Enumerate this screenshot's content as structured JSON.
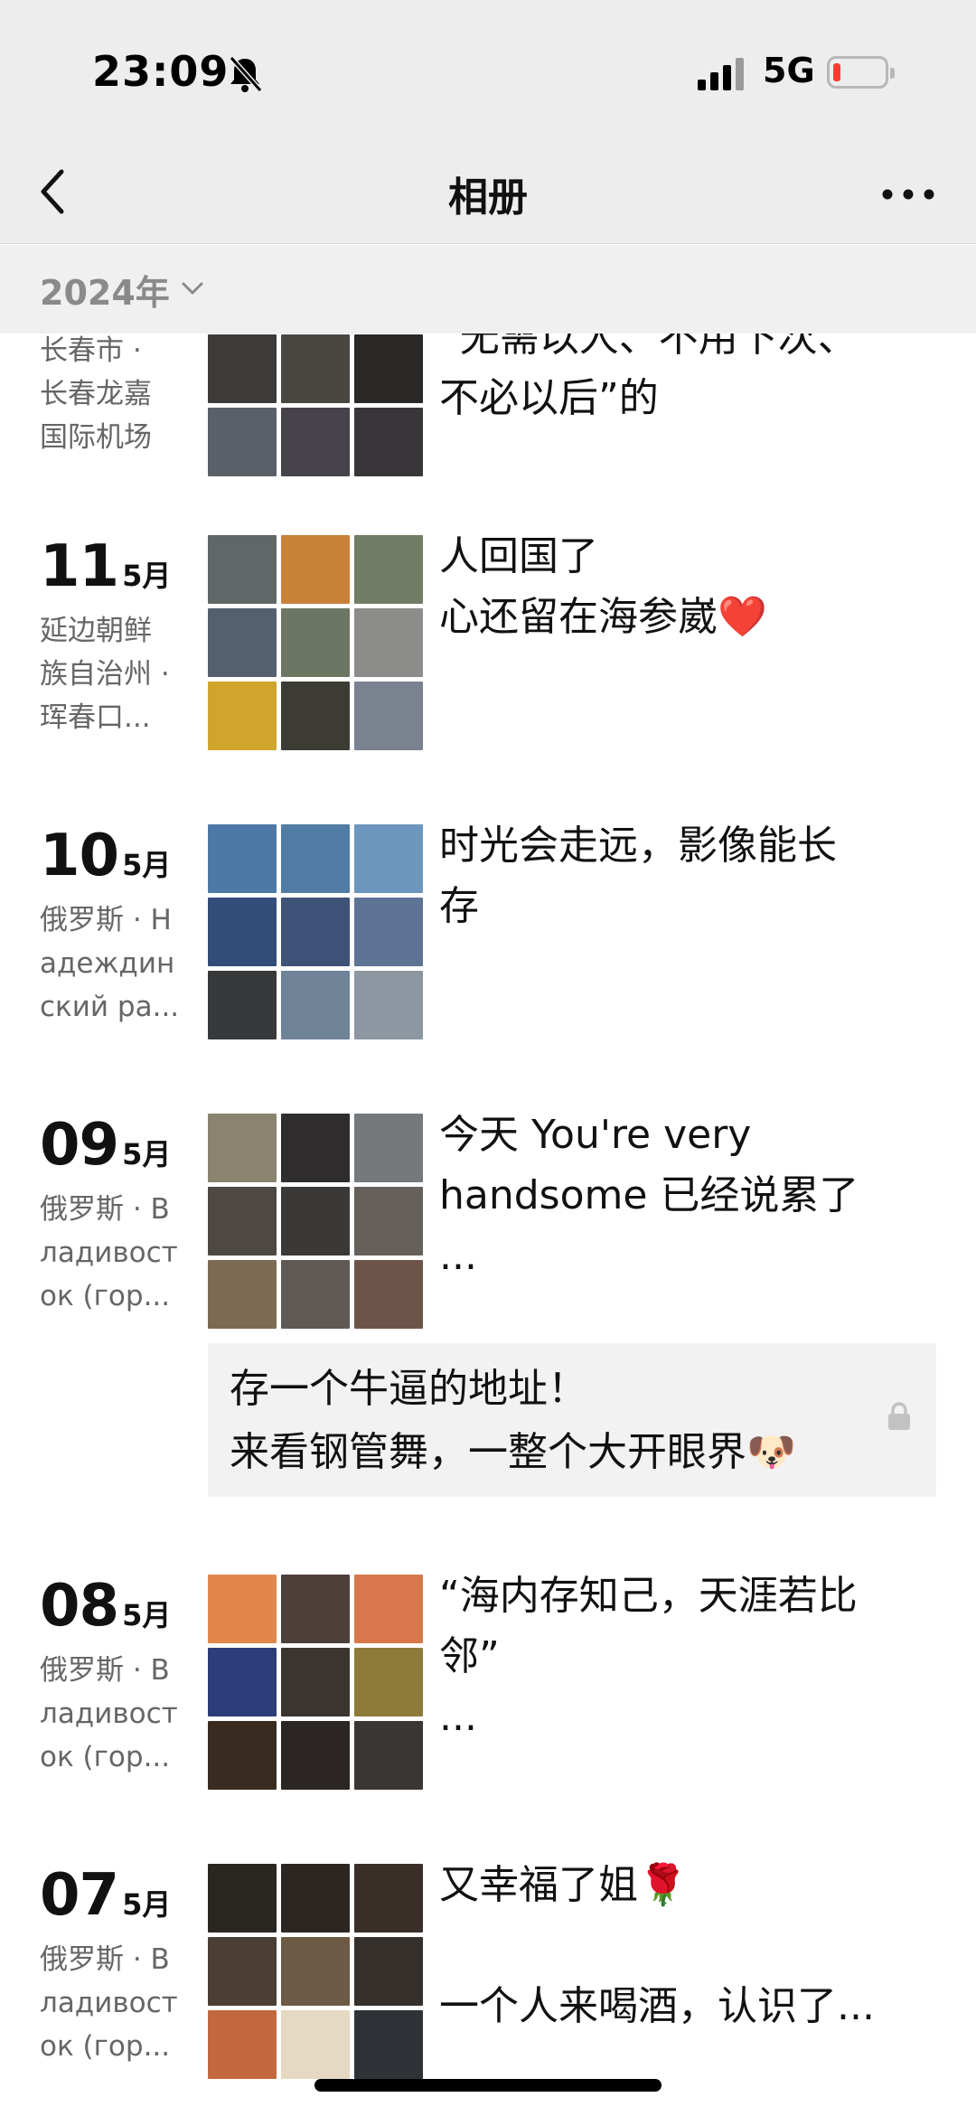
{
  "status": {
    "time": "23:09",
    "network": "5G",
    "battery_color": "#ff3b30"
  },
  "nav": {
    "title": "相册"
  },
  "year_header": {
    "label": "2024年"
  },
  "entries": [
    {
      "day": "",
      "month": "",
      "location": [
        "长春市 ·",
        "长春龙嘉",
        "国际机场"
      ],
      "caption": [
        "“无需以人、不用下次、",
        "不必以后”的"
      ],
      "photo_colors": [
        "#3c3b39",
        "#4a4642",
        "#2a2827",
        "#5b6068",
        "#46424a",
        "#39363a",
        "#514c47",
        "#2f3136",
        "#5d5549"
      ]
    },
    {
      "day": "11",
      "month": "5月",
      "location": [
        "延边朝鲜",
        "族自治州 ·",
        "珲春口..."
      ],
      "caption": [
        "人回国了",
        "心还留在海参崴❤️"
      ],
      "photo_colors": [
        "#5f6866",
        "#c9813a",
        "#707c64",
        "#54606e",
        "#6d7663",
        "#8c8d8b",
        "#d0a52c",
        "#3c3b34",
        "#7a8290"
      ]
    },
    {
      "day": "10",
      "month": "5月",
      "location": [
        "俄罗斯 · Н",
        "адеждин",
        "ский ра..."
      ],
      "caption": [
        "时光会走远，影像能长",
        "存"
      ],
      "photo_colors": [
        "#4d79a7",
        "#507ca5",
        "#6c96bd",
        "#324d79",
        "#3f5277",
        "#5d7494",
        "#37393b",
        "#6f8399",
        "#8c97a1"
      ]
    },
    {
      "day": "09",
      "month": "5月",
      "location": [
        "俄罗斯 · В",
        "ладивост",
        "ок (гор..."
      ],
      "caption": [
        "今天 You're very",
        "handsome 已经说累了",
        "..."
      ],
      "photo_colors": [
        "#8a8370",
        "#2e2c2c",
        "#75797b",
        "#4d4843",
        "#3a3937",
        "#66605a",
        "#7d6a52",
        "#5f5a55",
        "#6e5448"
      ]
    },
    {
      "day": "08",
      "month": "5月",
      "location": [
        "俄罗斯 · В",
        "ладивост",
        "ок (гор..."
      ],
      "caption": [
        "“海内存知己，天涯若比",
        "邻”",
        "..."
      ],
      "photo_colors": [
        "#e2874b",
        "#4d3f3a",
        "#d8774c",
        "#2d3d79",
        "#3b3530",
        "#8e7a3b",
        "#3a2b20",
        "#2b2523",
        "#3a3633"
      ]
    },
    {
      "day": "07",
      "month": "5月",
      "location": [
        "俄罗斯 · В",
        "ладивост",
        "ок (гор..."
      ],
      "caption": [
        "又幸福了姐🌹",
        "",
        "一个人来喝酒，认识了..."
      ],
      "photo_colors": [
        "#2a2622",
        "#2c2622",
        "#3a2f28",
        "#4a3e35",
        "#6c5a44",
        "#35302c",
        "#c4683f",
        "#e5d9c1",
        "#2f3338"
      ]
    }
  ],
  "link_card": {
    "lines": [
      "存一个牛逼的地址！",
      "来看钢管舞，一整个大开眼界🐶"
    ]
  }
}
